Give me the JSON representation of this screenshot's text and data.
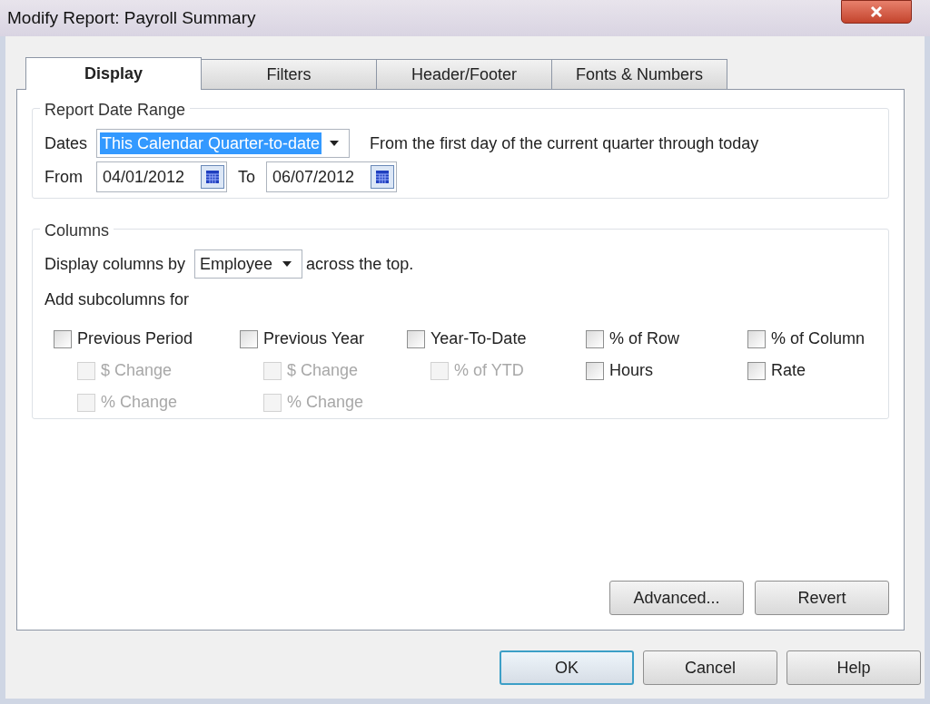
{
  "window": {
    "title": "Modify Report: Payroll Summary"
  },
  "tabs": [
    {
      "label": "Display",
      "selected": true
    },
    {
      "label": "Filters",
      "selected": false
    },
    {
      "label": "Header/Footer",
      "selected": false
    },
    {
      "label": "Fonts & Numbers",
      "selected": false
    }
  ],
  "date_range": {
    "legend": "Report Date Range",
    "dates_label": "Dates",
    "dates_value": "This Calendar Quarter-to-date",
    "dates_description": "From the first day of the current quarter through today",
    "from_label": "From",
    "from_value": "04/01/2012",
    "to_label": "To",
    "to_value": "06/07/2012"
  },
  "columns": {
    "legend": "Columns",
    "display_by_label": "Display columns by",
    "display_by_value": "Employee",
    "display_by_suffix": "across the top.",
    "subcolumns_label": "Add subcolumns for",
    "groups": [
      [
        {
          "label": "Previous Period",
          "checked": false,
          "disabled": false,
          "children": [
            {
              "label": "$ Change",
              "checked": false,
              "disabled": true
            },
            {
              "label": "% Change",
              "checked": false,
              "disabled": true
            }
          ]
        }
      ],
      [
        {
          "label": "Previous Year",
          "checked": false,
          "disabled": false,
          "children": [
            {
              "label": "$ Change",
              "checked": false,
              "disabled": true
            },
            {
              "label": "% Change",
              "checked": false,
              "disabled": true
            }
          ]
        }
      ],
      [
        {
          "label": "Year-To-Date",
          "checked": false,
          "disabled": false,
          "children": [
            {
              "label": "% of YTD",
              "checked": false,
              "disabled": true
            }
          ]
        }
      ],
      [
        {
          "label": "% of Row",
          "checked": false,
          "disabled": false
        },
        {
          "label": "Hours",
          "checked": false,
          "disabled": false
        }
      ],
      [
        {
          "label": "% of Column",
          "checked": false,
          "disabled": false
        },
        {
          "label": "Rate",
          "checked": false,
          "disabled": false
        }
      ]
    ]
  },
  "panel_buttons": [
    "Advanced...",
    "Revert"
  ],
  "dialog_buttons": [
    {
      "label": "OK",
      "default": true
    },
    {
      "label": "Cancel",
      "default": false
    },
    {
      "label": "Help",
      "default": false
    }
  ]
}
